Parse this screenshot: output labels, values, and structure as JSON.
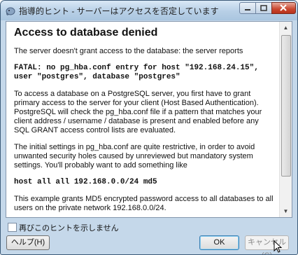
{
  "window": {
    "title": "指導的ヒント - サーバーはアクセスを否定しています"
  },
  "message": {
    "heading": "Access to database denied",
    "intro": "The server doesn't grant access to the database: the server reports",
    "error_line1": "FATAL: no pg_hba.conf entry for host \"192.168.24.15\",",
    "error_line2": "user \"postgres\", database \"postgres\"",
    "para1": "To access a database on a PostgreSQL server, you first have to grant primary access to the server for your client (Host Based Authentication). PostgreSQL will check the pg_hba.conf file if a pattern that matches your client address / username / database is present and enabled before any SQL GRANT access control lists are evaluated.",
    "para2": "The initial settings in pg_hba.conf are quite restrictive, in order to avoid unwanted security holes caused by unreviewed but mandatory system settings. You'll probably want to add something like",
    "code_example": "host all all 192.168.0.0/24 md5",
    "para3": "This example grants MD5 encrypted password access to all databases to all users on the private network 192.168.0.0/24."
  },
  "footer": {
    "checkbox_label": "再びこのヒントを示しません",
    "help_label": "ヘルプ(H)",
    "ok_label": "OK",
    "cancel_label": "キャンセル(C)"
  }
}
